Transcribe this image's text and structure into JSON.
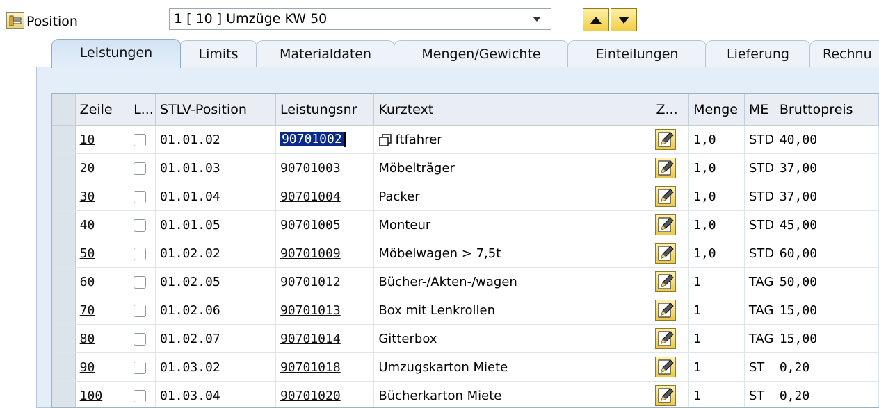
{
  "header": {
    "position_label": "Position",
    "position_value": "1 [ 10 ] Umzüge KW 50"
  },
  "tabs": [
    {
      "label": "Leistungen",
      "active": true
    },
    {
      "label": "Limits"
    },
    {
      "label": "Materialdaten"
    },
    {
      "label": "Mengen/Gewichte"
    },
    {
      "label": "Einteilungen"
    },
    {
      "label": "Lieferung"
    },
    {
      "label": "Rechnu"
    }
  ],
  "table": {
    "columns": [
      "Zeile",
      "L...",
      "STLV-Position",
      "Leistungsnr",
      "Kurztext",
      "Z...",
      "Menge",
      "ME",
      "Bruttopreis"
    ],
    "rows": [
      {
        "zeile": "10",
        "stlv": "01.01.02",
        "nr": "90701002",
        "kurztext": "ftfahrer",
        "menge": "1,0",
        "me": "STD",
        "preis": "40,00"
      },
      {
        "zeile": "20",
        "stlv": "01.01.03",
        "nr": "90701003",
        "kurztext": "Möbelträger",
        "menge": "1,0",
        "me": "STD",
        "preis": "37,00"
      },
      {
        "zeile": "30",
        "stlv": "01.01.04",
        "nr": "90701004",
        "kurztext": "Packer",
        "menge": "1,0",
        "me": "STD",
        "preis": "37,00"
      },
      {
        "zeile": "40",
        "stlv": "01.01.05",
        "nr": "90701005",
        "kurztext": "Monteur",
        "menge": "1,0",
        "me": "STD",
        "preis": "45,00"
      },
      {
        "zeile": "50",
        "stlv": "01.02.02",
        "nr": "90701009",
        "kurztext": "Möbelwagen > 7,5t",
        "menge": "1,0",
        "me": "STD",
        "preis": "60,00"
      },
      {
        "zeile": "60",
        "stlv": "01.02.05",
        "nr": "90701012",
        "kurztext": "Bücher-/Akten-/wagen",
        "menge": "1",
        "me": "TAG",
        "preis": "50,00"
      },
      {
        "zeile": "70",
        "stlv": "01.02.06",
        "nr": "90701013",
        "kurztext": "Box mit Lenkrollen",
        "menge": "1",
        "me": "TAG",
        "preis": "15,00"
      },
      {
        "zeile": "80",
        "stlv": "01.02.07",
        "nr": "90701014",
        "kurztext": "Gitterbox",
        "menge": "1",
        "me": "TAG",
        "preis": "15,00"
      },
      {
        "zeile": "90",
        "stlv": "01.03.02",
        "nr": "90701018",
        "kurztext": "Umzugskarton Miete",
        "menge": "1",
        "me": "ST",
        "preis": "0,20"
      },
      {
        "zeile": "100",
        "stlv": "01.03.04",
        "nr": "90701020",
        "kurztext": "Bücherkarton Miete",
        "menge": "1",
        "me": "ST",
        "preis": "0,20"
      }
    ]
  },
  "icons": {
    "position": "position-icon",
    "nav_up": "arrow-up-icon",
    "nav_down": "arrow-down-icon",
    "copy": "copy-icon",
    "edit": "edit-pencil-icon"
  },
  "colors": {
    "selection": "#0a2a88",
    "tab_active": "#d3e3f4",
    "panel_bg": "#e4eef9",
    "button_yellow": "#f1cf45"
  }
}
